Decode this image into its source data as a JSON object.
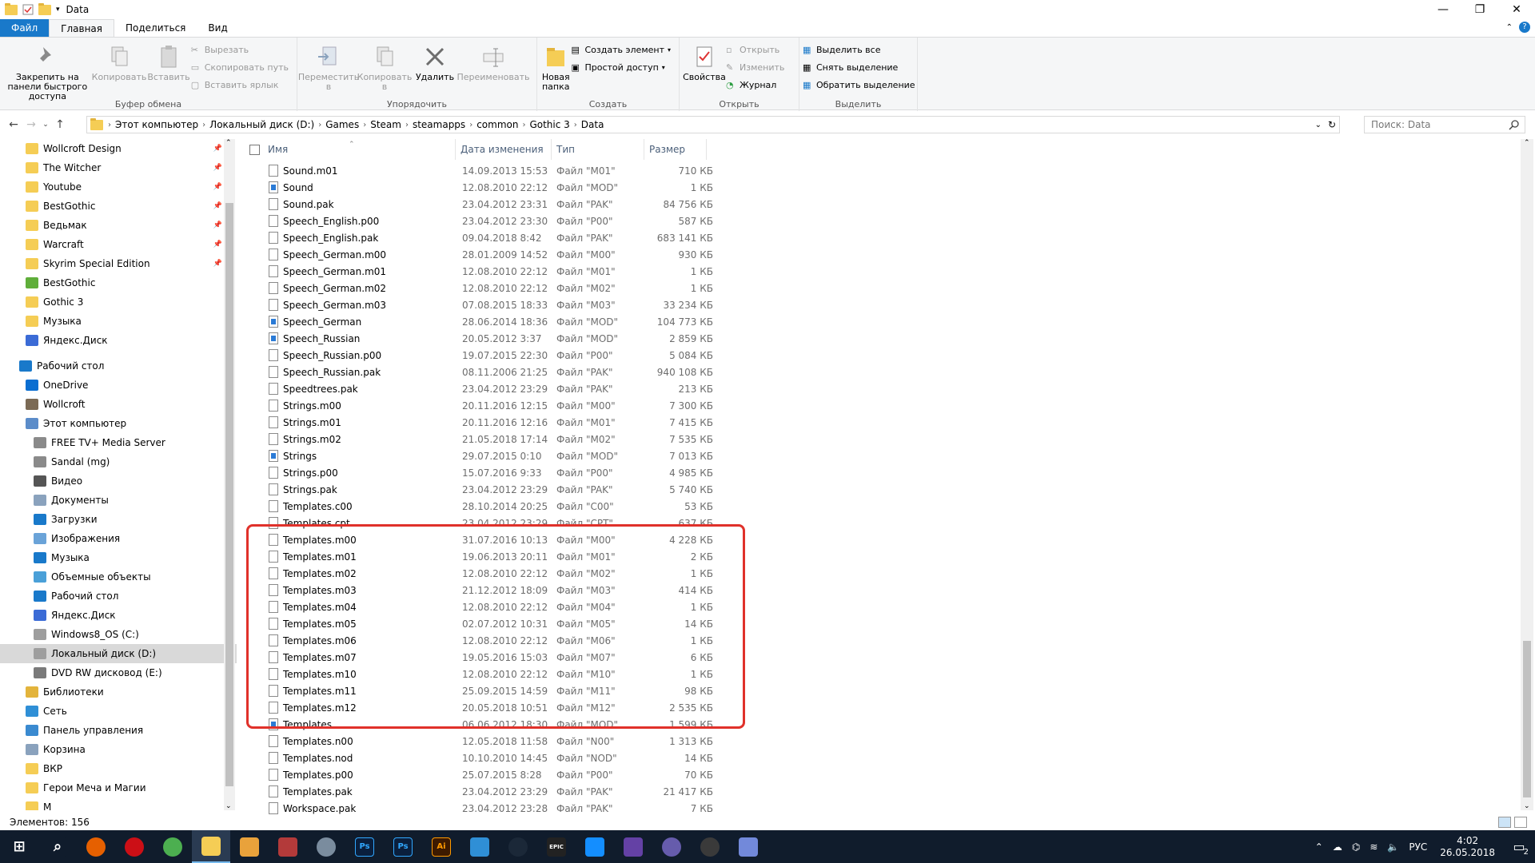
{
  "window": {
    "title": "Data"
  },
  "ribbon_tabs": [
    "Файл",
    "Главная",
    "Поделиться",
    "Вид"
  ],
  "ribbon": {
    "clipboard": {
      "label": "Буфер обмена",
      "pin": "Закрепить на панели быстрого доступа",
      "copy": "Копировать",
      "paste": "Вставить",
      "cut": "Вырезать",
      "copy_path": "Скопировать путь",
      "paste_shortcut": "Вставить ярлык"
    },
    "organize": {
      "label": "Упорядочить",
      "move": "Переместить в",
      "copy_to": "Копировать в",
      "delete": "Удалить",
      "rename": "Переименовать"
    },
    "create": {
      "label": "Создать",
      "new_folder": "Новая папка",
      "new_item": "Создать элемент",
      "easy_access": "Простой доступ"
    },
    "open": {
      "label": "Открыть",
      "properties": "Свойства",
      "open": "Открыть",
      "edit": "Изменить",
      "history": "Журнал"
    },
    "select": {
      "label": "Выделить",
      "select_all": "Выделить все",
      "select_none": "Снять выделение",
      "invert": "Обратить выделение"
    }
  },
  "breadcrumbs": [
    "Этот компьютер",
    "Локальный диск (D:)",
    "Games",
    "Steam",
    "steamapps",
    "common",
    "Gothic 3",
    "Data"
  ],
  "search": {
    "placeholder": "Поиск: Data"
  },
  "nav_items": [
    {
      "label": "Wollcroft Design",
      "icon": "folder-icon",
      "pinned": true,
      "indent": 1
    },
    {
      "label": "The Witcher",
      "icon": "folder-icon",
      "pinned": true,
      "indent": 1
    },
    {
      "label": "Youtube",
      "icon": "folder-icon",
      "pinned": true,
      "indent": 1
    },
    {
      "label": "BestGothic",
      "icon": "folder-icon",
      "pinned": true,
      "indent": 1
    },
    {
      "label": "Ведьмак",
      "icon": "folder-icon",
      "pinned": true,
      "indent": 1
    },
    {
      "label": "Warcraft",
      "icon": "folder-icon",
      "pinned": true,
      "indent": 1
    },
    {
      "label": "Skyrim Special Edition",
      "icon": "folder-icon",
      "pinned": true,
      "indent": 1
    },
    {
      "label": "BestGothic",
      "icon": "network-folder-icon",
      "pinned": false,
      "indent": 1
    },
    {
      "label": "Gothic 3",
      "icon": "folder-icon",
      "pinned": false,
      "indent": 1
    },
    {
      "label": "Музыка",
      "icon": "folder-icon",
      "pinned": false,
      "indent": 1
    },
    {
      "label": "Яндекс.Диск",
      "icon": "yandex-disk-icon",
      "pinned": false,
      "indent": 1
    },
    {
      "label": "",
      "icon": "",
      "pinned": false,
      "indent": 0
    },
    {
      "label": "Рабочий стол",
      "icon": "desktop-icon",
      "pinned": false,
      "indent": 0
    },
    {
      "label": "OneDrive",
      "icon": "onedrive-icon",
      "pinned": false,
      "indent": 1
    },
    {
      "label": "Wollcroft",
      "icon": "user-icon",
      "pinned": false,
      "indent": 1
    },
    {
      "label": "Этот компьютер",
      "icon": "computer-icon",
      "pinned": false,
      "indent": 1
    },
    {
      "label": "FREE TV+ Media Server",
      "icon": "media-server-icon",
      "pinned": false,
      "indent": 2
    },
    {
      "label": "Sandal (mg)",
      "icon": "media-server-icon",
      "pinned": false,
      "indent": 2
    },
    {
      "label": "Видео",
      "icon": "video-icon",
      "pinned": false,
      "indent": 2
    },
    {
      "label": "Документы",
      "icon": "documents-icon",
      "pinned": false,
      "indent": 2
    },
    {
      "label": "Загрузки",
      "icon": "downloads-icon",
      "pinned": false,
      "indent": 2
    },
    {
      "label": "Изображения",
      "icon": "pictures-icon",
      "pinned": false,
      "indent": 2
    },
    {
      "label": "Музыка",
      "icon": "music-icon",
      "pinned": false,
      "indent": 2
    },
    {
      "label": "Объемные объекты",
      "icon": "3d-objects-icon",
      "pinned": false,
      "indent": 2
    },
    {
      "label": "Рабочий стол",
      "icon": "desktop-icon",
      "pinned": false,
      "indent": 2
    },
    {
      "label": "Яндекс.Диск",
      "icon": "yandex-disk-icon",
      "pinned": false,
      "indent": 2
    },
    {
      "label": "Windows8_OS (C:)",
      "icon": "drive-icon",
      "pinned": false,
      "indent": 2
    },
    {
      "label": "Локальный диск (D:)",
      "icon": "drive-icon",
      "pinned": false,
      "indent": 2,
      "selected": true
    },
    {
      "label": "DVD RW дисковод (E:)",
      "icon": "dvd-drive-icon",
      "pinned": false,
      "indent": 2
    },
    {
      "label": "Библиотеки",
      "icon": "libraries-icon",
      "pinned": false,
      "indent": 1
    },
    {
      "label": "Сеть",
      "icon": "network-icon",
      "pinned": false,
      "indent": 1
    },
    {
      "label": "Панель управления",
      "icon": "control-panel-icon",
      "pinned": false,
      "indent": 1
    },
    {
      "label": "Корзина",
      "icon": "recycle-bin-icon",
      "pinned": false,
      "indent": 1
    },
    {
      "label": "ВКР",
      "icon": "folder-icon",
      "pinned": false,
      "indent": 1
    },
    {
      "label": "Герои Меча и Магии",
      "icon": "folder-icon",
      "pinned": false,
      "indent": 1
    },
    {
      "label": "М",
      "icon": "folder-icon",
      "pinned": false,
      "indent": 1
    }
  ],
  "columns": {
    "name": "Имя",
    "date": "Дата изменения",
    "type": "Тип",
    "size": "Размер"
  },
  "files": [
    {
      "name": "Sound.m01",
      "date": "14.09.2013 15:53",
      "type": "Файл \"M01\"",
      "size": "710 КБ",
      "mod": false
    },
    {
      "name": "Sound",
      "date": "12.08.2010 22:12",
      "type": "Файл \"MOD\"",
      "size": "1 КБ",
      "mod": true
    },
    {
      "name": "Sound.pak",
      "date": "23.04.2012 23:31",
      "type": "Файл \"PAK\"",
      "size": "84 756 КБ",
      "mod": false
    },
    {
      "name": "Speech_English.p00",
      "date": "23.04.2012 23:30",
      "type": "Файл \"P00\"",
      "size": "587 КБ",
      "mod": false
    },
    {
      "name": "Speech_English.pak",
      "date": "09.04.2018 8:42",
      "type": "Файл \"PAK\"",
      "size": "683 141 КБ",
      "mod": false
    },
    {
      "name": "Speech_German.m00",
      "date": "28.01.2009 14:52",
      "type": "Файл \"M00\"",
      "size": "930 КБ",
      "mod": false
    },
    {
      "name": "Speech_German.m01",
      "date": "12.08.2010 22:12",
      "type": "Файл \"M01\"",
      "size": "1 КБ",
      "mod": false
    },
    {
      "name": "Speech_German.m02",
      "date": "12.08.2010 22:12",
      "type": "Файл \"M02\"",
      "size": "1 КБ",
      "mod": false
    },
    {
      "name": "Speech_German.m03",
      "date": "07.08.2015 18:33",
      "type": "Файл \"M03\"",
      "size": "33 234 КБ",
      "mod": false
    },
    {
      "name": "Speech_German",
      "date": "28.06.2014 18:36",
      "type": "Файл \"MOD\"",
      "size": "104 773 КБ",
      "mod": true
    },
    {
      "name": "Speech_Russian",
      "date": "20.05.2012 3:37",
      "type": "Файл \"MOD\"",
      "size": "2 859 КБ",
      "mod": true
    },
    {
      "name": "Speech_Russian.p00",
      "date": "19.07.2015 22:30",
      "type": "Файл \"P00\"",
      "size": "5 084 КБ",
      "mod": false
    },
    {
      "name": "Speech_Russian.pak",
      "date": "08.11.2006 21:25",
      "type": "Файл \"PAK\"",
      "size": "940 108 КБ",
      "mod": false
    },
    {
      "name": "Speedtrees.pak",
      "date": "23.04.2012 23:29",
      "type": "Файл \"PAK\"",
      "size": "213 КБ",
      "mod": false
    },
    {
      "name": "Strings.m00",
      "date": "20.11.2016 12:15",
      "type": "Файл \"M00\"",
      "size": "7 300 КБ",
      "mod": false
    },
    {
      "name": "Strings.m01",
      "date": "20.11.2016 12:16",
      "type": "Файл \"M01\"",
      "size": "7 415 КБ",
      "mod": false
    },
    {
      "name": "Strings.m02",
      "date": "21.05.2018 17:14",
      "type": "Файл \"M02\"",
      "size": "7 535 КБ",
      "mod": false
    },
    {
      "name": "Strings",
      "date": "29.07.2015 0:10",
      "type": "Файл \"MOD\"",
      "size": "7 013 КБ",
      "mod": true
    },
    {
      "name": "Strings.p00",
      "date": "15.07.2016 9:33",
      "type": "Файл \"P00\"",
      "size": "4 985 КБ",
      "mod": false
    },
    {
      "name": "Strings.pak",
      "date": "23.04.2012 23:29",
      "type": "Файл \"PAK\"",
      "size": "5 740 КБ",
      "mod": false
    },
    {
      "name": "Templates.c00",
      "date": "28.10.2014 20:25",
      "type": "Файл \"C00\"",
      "size": "53 КБ",
      "mod": false
    },
    {
      "name": "Templates.cpt",
      "date": "23.04.2012 23:29",
      "type": "Файл \"CPT\"",
      "size": "637 КБ",
      "mod": false
    },
    {
      "name": "Templates.m00",
      "date": "31.07.2016 10:13",
      "type": "Файл \"M00\"",
      "size": "4 228 КБ",
      "mod": false
    },
    {
      "name": "Templates.m01",
      "date": "19.06.2013 20:11",
      "type": "Файл \"M01\"",
      "size": "2 КБ",
      "mod": false
    },
    {
      "name": "Templates.m02",
      "date": "12.08.2010 22:12",
      "type": "Файл \"M02\"",
      "size": "1 КБ",
      "mod": false
    },
    {
      "name": "Templates.m03",
      "date": "21.12.2012 18:09",
      "type": "Файл \"M03\"",
      "size": "414 КБ",
      "mod": false
    },
    {
      "name": "Templates.m04",
      "date": "12.08.2010 22:12",
      "type": "Файл \"M04\"",
      "size": "1 КБ",
      "mod": false
    },
    {
      "name": "Templates.m05",
      "date": "02.07.2012 10:31",
      "type": "Файл \"M05\"",
      "size": "14 КБ",
      "mod": false
    },
    {
      "name": "Templates.m06",
      "date": "12.08.2010 22:12",
      "type": "Файл \"M06\"",
      "size": "1 КБ",
      "mod": false
    },
    {
      "name": "Templates.m07",
      "date": "19.05.2016 15:03",
      "type": "Файл \"M07\"",
      "size": "6 КБ",
      "mod": false
    },
    {
      "name": "Templates.m10",
      "date": "12.08.2010 22:12",
      "type": "Файл \"M10\"",
      "size": "1 КБ",
      "mod": false
    },
    {
      "name": "Templates.m11",
      "date": "25.09.2015 14:59",
      "type": "Файл \"M11\"",
      "size": "98 КБ",
      "mod": false
    },
    {
      "name": "Templates.m12",
      "date": "20.05.2018 10:51",
      "type": "Файл \"M12\"",
      "size": "2 535 КБ",
      "mod": false
    },
    {
      "name": "Templates",
      "date": "06.06.2012 18:30",
      "type": "Файл \"MOD\"",
      "size": "1 599 КБ",
      "mod": true
    },
    {
      "name": "Templates.n00",
      "date": "12.05.2018 11:58",
      "type": "Файл \"N00\"",
      "size": "1 313 КБ",
      "mod": false
    },
    {
      "name": "Templates.nod",
      "date": "10.10.2010 14:45",
      "type": "Файл \"NOD\"",
      "size": "14 КБ",
      "mod": false
    },
    {
      "name": "Templates.p00",
      "date": "25.07.2015 8:28",
      "type": "Файл \"P00\"",
      "size": "70 КБ",
      "mod": false
    },
    {
      "name": "Templates.pak",
      "date": "23.04.2012 23:29",
      "type": "Файл \"PAK\"",
      "size": "21 417 КБ",
      "mod": false
    },
    {
      "name": "Workspace.pak",
      "date": "23.04.2012 23:28",
      "type": "Файл \"PAK\"",
      "size": "7 КБ",
      "mod": false
    }
  ],
  "status": {
    "items_count": "Элементов: 156"
  },
  "taskbar": {
    "apps": [
      {
        "name": "start-button",
        "label": "",
        "color": "#101c2c"
      },
      {
        "name": "search-taskbar-button",
        "label": "",
        "color": "#101c2c"
      },
      {
        "name": "firefox-icon",
        "label": "",
        "color": "#e66000"
      },
      {
        "name": "opera-icon",
        "label": "",
        "color": "#cc0f16"
      },
      {
        "name": "chrome-icon",
        "label": "",
        "color": "#4caf50"
      },
      {
        "name": "file-explorer-icon",
        "label": "",
        "color": "#f5cd55"
      },
      {
        "name": "media-player-icon",
        "label": "",
        "color": "#e9a23b"
      },
      {
        "name": "game-app-icon",
        "label": "",
        "color": "#b33a3a"
      },
      {
        "name": "gothic-app-icon",
        "label": "",
        "color": "#7a8c9e"
      },
      {
        "name": "photoshop-icon",
        "label": "Ps",
        "color": "#0a1f3d"
      },
      {
        "name": "photoshop-2-icon",
        "label": "Ps",
        "color": "#0a1f3d"
      },
      {
        "name": "illustrator-icon",
        "label": "Ai",
        "color": "#3d1a00"
      },
      {
        "name": "photos-app-icon",
        "label": "",
        "color": "#2f8fd6"
      },
      {
        "name": "steam-icon",
        "label": "",
        "color": "#1b2838"
      },
      {
        "name": "epic-games-icon",
        "label": "EPIC",
        "color": "#222"
      },
      {
        "name": "battlenet-icon",
        "label": "",
        "color": "#148eff"
      },
      {
        "name": "twitch-icon",
        "label": "",
        "color": "#6441a5"
      },
      {
        "name": "viber-icon",
        "label": "",
        "color": "#665cac"
      },
      {
        "name": "app-icon",
        "label": "",
        "color": "#3a3a3a"
      },
      {
        "name": "discord-icon",
        "label": "",
        "color": "#7289da"
      }
    ],
    "lang": "РУС",
    "time": "4:02",
    "date": "26.05.2018",
    "notifications": "2"
  }
}
